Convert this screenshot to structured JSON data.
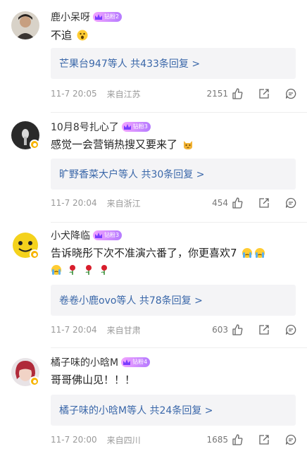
{
  "comments": [
    {
      "username": "鹿小呆呀",
      "fan_badge": "钻粉2",
      "text": "不追",
      "text_emojis": [
        "scared-emoji"
      ],
      "reply_summary": "芒果台947等人 共433条回复 >",
      "date": "11-7 20:05",
      "source": "来自江苏",
      "likes": "2151",
      "avatar": "portrait-avatar"
    },
    {
      "username": "10月8号扎心了",
      "fan_badge": "钻粉3",
      "text": "感觉一会营销热搜又要来了",
      "text_emojis": [
        "cat-emoji"
      ],
      "reply_summary": "旷野香菜大户等人 共30条回复 >",
      "date": "11-7 20:04",
      "source": "来自浙江",
      "likes": "454",
      "avatar": "dark-avatar"
    },
    {
      "username": "小犬降临",
      "fan_badge": "钻粉3",
      "text": "告诉晓彤下次不准演六番了，你更喜欢7",
      "text_emojis": [
        "crying-emoji",
        "crying-emoji",
        "crying-emoji",
        "rose-emoji",
        "rose-emoji",
        "rose-emoji"
      ],
      "reply_summary": "卷卷小鹿ovo等人 共78条回复 >",
      "date": "11-7 20:04",
      "source": "来自甘肃",
      "likes": "603",
      "avatar": "yellow-face-avatar"
    },
    {
      "username": "橘子味的小晗M",
      "fan_badge": "钻粉4",
      "text": "哥哥佛山见！！！",
      "text_emojis": [],
      "reply_summary": "橘子味的小晗M等人 共24条回复 >",
      "date": "11-7 20:00",
      "source": "来自四川",
      "likes": "1685",
      "avatar": "red-hair-avatar"
    }
  ],
  "icons": {
    "like": "thumbs-up-icon",
    "share": "share-icon",
    "comment": "comment-icon",
    "verified": "verified-badge-icon",
    "crown": "crown-icon"
  },
  "colors": {
    "link_blue": "#3a67a9",
    "reply_bg": "#f4f4f6",
    "meta_gray": "#999999",
    "badge_gradient_start": "#f3a3ff",
    "badge_gradient_end": "#b57bff",
    "verified_gold": "#f6b400"
  }
}
